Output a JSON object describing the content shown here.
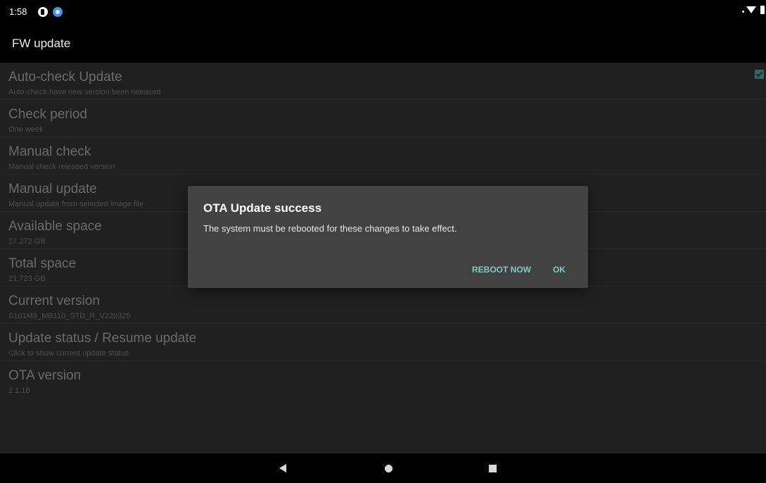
{
  "status_bar": {
    "time": "1:58",
    "icons": [
      "notification-icon",
      "browser-notification-icon",
      "wifi-icon",
      "battery-icon"
    ]
  },
  "app_bar": {
    "title": "FW update"
  },
  "settings": [
    {
      "title": "Auto-check Update",
      "summary": "Auto-check have new version been released",
      "checked": true
    },
    {
      "title": "Check period",
      "summary": "One week"
    },
    {
      "title": "Manual check",
      "summary": "Manual check released version"
    },
    {
      "title": "Manual update",
      "summary": "Manual update from selected image file"
    },
    {
      "title": "Available space",
      "summary": "17.272 GB"
    },
    {
      "title": "Total space",
      "summary": "21.723 GB"
    },
    {
      "title": "Current version",
      "summary": "S101M9_MB110_STD_R_V220325"
    },
    {
      "title": "Update status / Resume update",
      "summary": "Click to show current update status"
    },
    {
      "title": "OTA version",
      "summary": "2.1.18"
    }
  ],
  "dialog": {
    "title": "OTA Update success",
    "message": "The system must be rebooted for these changes to take effect.",
    "buttons": {
      "reboot_now": "REBOOT NOW",
      "ok": "OK"
    }
  },
  "nav_bar": {
    "icons": [
      "back-icon",
      "home-icon",
      "recents-icon"
    ]
  },
  "colors": {
    "accent": "#80cbc4",
    "dialog_bg": "#424242",
    "screen_bg": "#202020"
  }
}
